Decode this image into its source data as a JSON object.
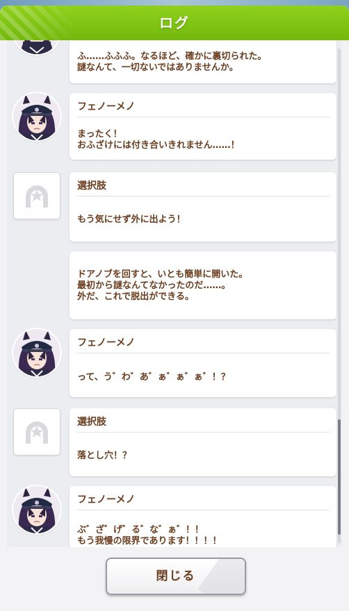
{
  "header": {
    "title": "ログ"
  },
  "entries": [
    {
      "type": "dialogue",
      "speaker": "",
      "text": "ふ……ふふふ。なるほど、確かに裏切られた。\n謎なんて、一切ないではありませんか。"
    },
    {
      "type": "dialogue",
      "speaker": "フェノーメノ",
      "text": "まったく！\nおふざけには付き合いきれません……！"
    },
    {
      "type": "choice",
      "speaker": "選択肢",
      "text": "もう気にせず外に出よう！"
    },
    {
      "type": "narration",
      "speaker": "",
      "text": "ドアノブを回すと、いとも簡単に開いた。\n最初から謎なんてなかったのだ……。\n外だ、これで脱出ができる。"
    },
    {
      "type": "dialogue",
      "speaker": "フェノーメノ",
      "text": "って、う゛わ゛あ゛ぁ゛ぁ゛ぁ゛！？"
    },
    {
      "type": "choice",
      "speaker": "選択肢",
      "text": "落とし穴！？"
    },
    {
      "type": "dialogue",
      "speaker": "フェノーメノ",
      "text": "ぶ゛ざ゛げ゛る゛な゛ぁ゛！！\nもう我慢の限界であります！！！！"
    }
  ],
  "footer": {
    "close_label": "閉じる"
  },
  "colors": {
    "header_green": "#7ec513",
    "text_brown": "#6b3d1e",
    "panel_bg": "#ecedf1"
  },
  "icons": {
    "portrait": "character-portrait",
    "choice": "horseshoe-star-icon"
  }
}
